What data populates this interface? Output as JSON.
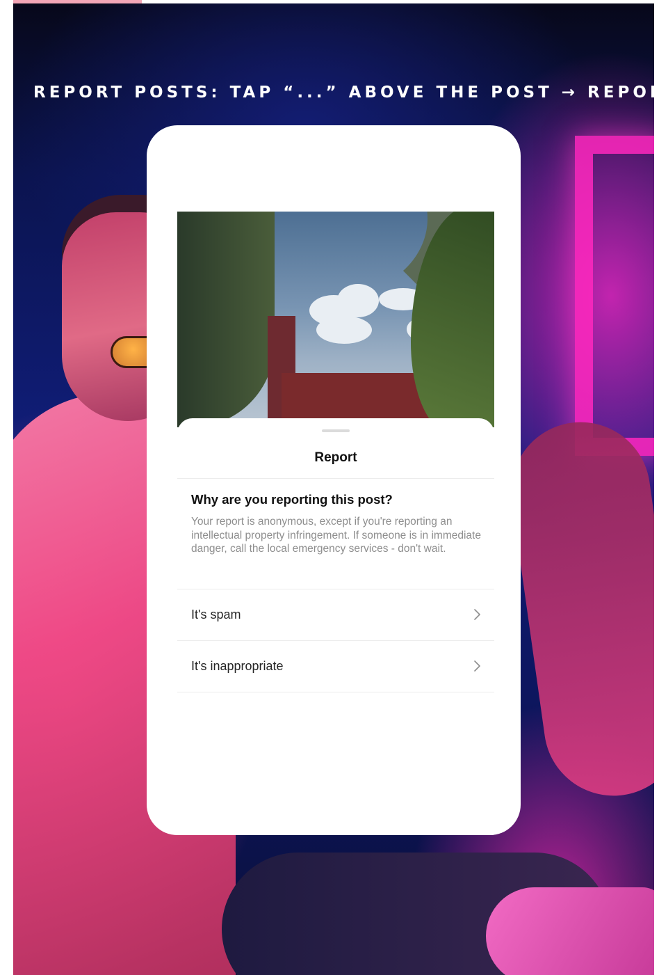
{
  "caption": "REPORT POSTS: TAP “...” ABOVE THE POST → REPORT",
  "sheet": {
    "title": "Report",
    "question": "Why are you reporting this post?",
    "explanation": "Your report is anonymous, except if you're reporting an intellectual property infringement. If someone is in immediate danger, call the local emergency services - don't wait.",
    "options": [
      {
        "label": "It's spam",
        "icon": "chevron-right-icon"
      },
      {
        "label": "It's inappropriate",
        "icon": "chevron-right-icon"
      }
    ]
  },
  "colors": {
    "accent_tab": "#f3a6b6",
    "caption_text": "#ffffff",
    "secondary_text": "#8e8e8e",
    "divider": "#ececec"
  }
}
